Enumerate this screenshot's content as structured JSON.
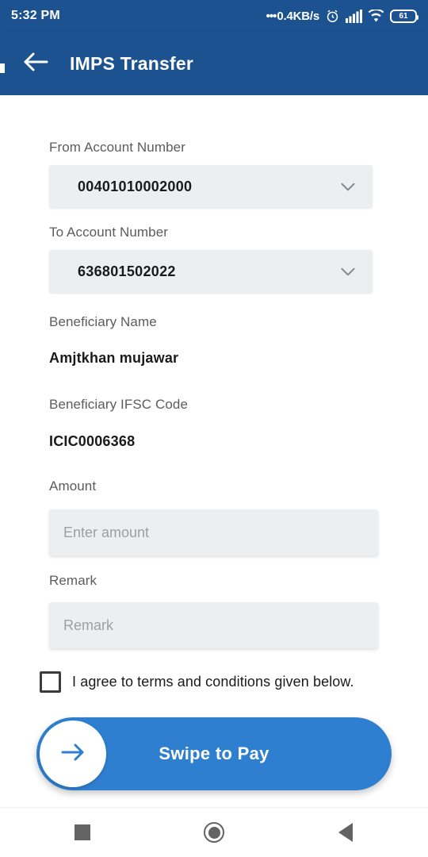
{
  "status_bar": {
    "time": "5:32 PM",
    "network_speed": "0.4KB/s",
    "dots": "•••",
    "alarm_icon": "alarm-clock-icon",
    "signal_icon": "cellular-signal-icon",
    "wifi_icon": "wifi-icon",
    "battery_level": "61"
  },
  "app_bar": {
    "back_icon": "back-arrow-icon",
    "title": "IMPS Transfer",
    "background_color": "#1d5291"
  },
  "form": {
    "from_account": {
      "label": "From Account Number",
      "value": "00401010002000",
      "chevron_icon": "chevron-down-icon"
    },
    "to_account": {
      "label": "To Account Number",
      "value": "636801502022",
      "chevron_icon": "chevron-down-icon"
    },
    "beneficiary_name": {
      "label": "Beneficiary Name",
      "value": "Amjtkhan mujawar"
    },
    "beneficiary_ifsc": {
      "label": "Beneficiary IFSC Code",
      "value": "ICIC0006368"
    },
    "amount": {
      "label": "Amount",
      "value": "",
      "placeholder": "Enter amount"
    },
    "remark": {
      "label": "Remark",
      "value": "",
      "placeholder": "Remark"
    },
    "terms": {
      "checked": false,
      "label": "I agree to terms and conditions given below."
    }
  },
  "swipe_button": {
    "label": "Swipe to Pay",
    "thumb_icon": "arrow-right-icon",
    "color": "#2f7fd0"
  },
  "nav_bar": {
    "recents_icon": "square-recents-icon",
    "home_icon": "circle-home-icon",
    "back_icon": "triangle-back-icon"
  }
}
